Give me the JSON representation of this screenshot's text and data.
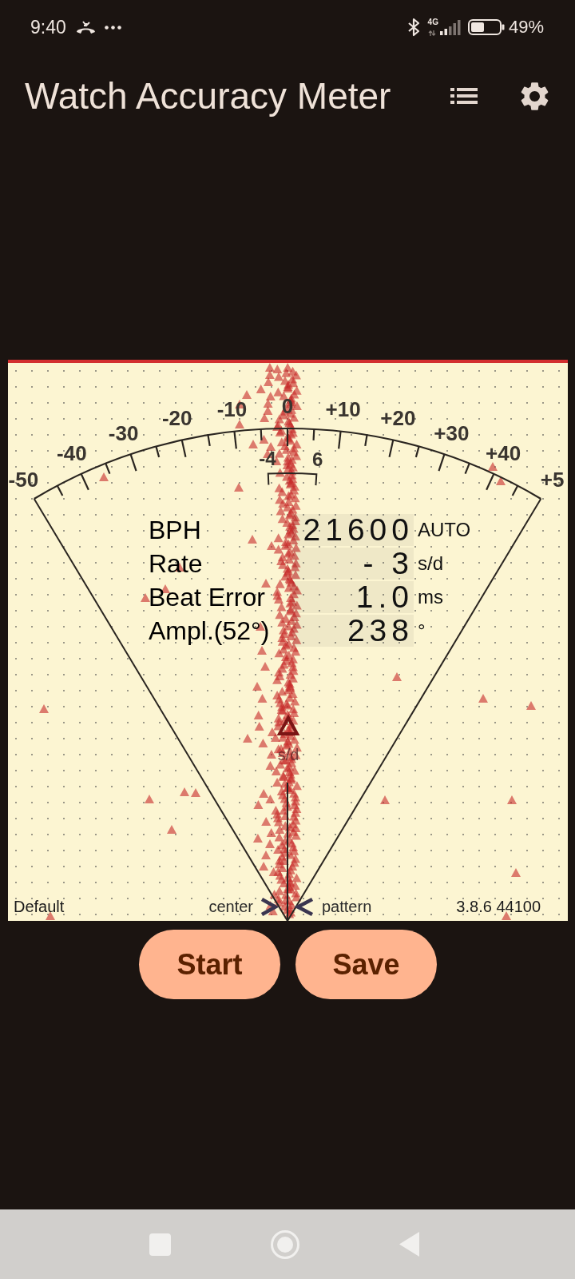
{
  "status_bar": {
    "time": "9:40",
    "network_type": "4G",
    "battery_percent": "49%"
  },
  "app_bar": {
    "title": "Watch Accuracy Meter"
  },
  "meter": {
    "scale_labels": [
      "-50",
      "-40",
      "-30",
      "-20",
      "-10",
      "0",
      "+10",
      "+20",
      "+30",
      "+40",
      "+5"
    ],
    "range_labels": [
      "-4",
      "6"
    ],
    "marker_label": "s/d",
    "readouts": [
      {
        "label": "BPH",
        "value": "21600",
        "unit": "AUTO"
      },
      {
        "label": "Rate",
        "value": "- 3",
        "unit": "s/d"
      },
      {
        "label": "Beat Error",
        "value": "1.0",
        "unit": "ms"
      },
      {
        "label": "Ampl.(52°)",
        "value": "238",
        "unit": "°"
      }
    ],
    "footer": {
      "left": "Default",
      "center_left": "center",
      "center_right": "pattern",
      "right": "3.8.6 44100"
    }
  },
  "buttons": [
    {
      "label": "Start"
    },
    {
      "label": "Save"
    }
  ]
}
